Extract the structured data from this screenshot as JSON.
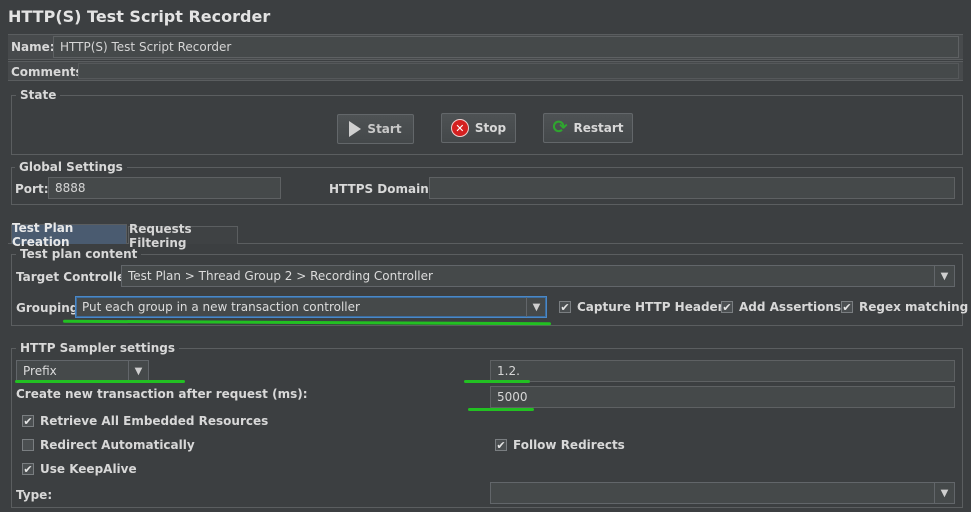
{
  "window": {
    "title": "HTTP(S) Test Script Recorder"
  },
  "name": {
    "label": "Name:",
    "value": "HTTP(S) Test Script Recorder"
  },
  "comments": {
    "label": "Comments:",
    "value": ""
  },
  "state": {
    "title": "State",
    "start_label": "Start",
    "stop_label": "Stop",
    "restart_label": "Restart"
  },
  "global": {
    "title": "Global Settings",
    "port_label": "Port:",
    "port_value": "8888",
    "https_label": "HTTPS Domains:",
    "https_value": ""
  },
  "tabs": [
    {
      "label": "Test Plan Creation",
      "active": true
    },
    {
      "label": "Requests Filtering",
      "active": false
    }
  ],
  "plan": {
    "title": "Test plan content",
    "target_label": "Target Controller:",
    "target_value": "Test Plan > Thread Group 2 > Recording Controller",
    "grouping_label": "Grouping:",
    "grouping_value": "Put each group in a new transaction controller",
    "capture_headers": "Capture HTTP Headers",
    "add_assertions": "Add Assertions",
    "regex_matching": "Regex matching"
  },
  "sampler": {
    "title": "HTTP Sampler settings",
    "naming_value": "Prefix",
    "prefix_value": "1.2.",
    "transaction_label": "Create new transaction after request (ms):",
    "transaction_value": "5000",
    "retrieve_resources": "Retrieve All Embedded Resources",
    "redirect_auto": "Redirect Automatically",
    "follow_redirects": "Follow Redirects",
    "keepalive": "Use KeepAlive",
    "type_label": "Type:",
    "type_value": ""
  },
  "colors": {
    "background": "#3c3f41",
    "field": "#45494a",
    "active_tab": "#4a5b70",
    "highlight": "#22c022",
    "stop_red": "#d42020",
    "restart_green": "#2fa52f"
  }
}
